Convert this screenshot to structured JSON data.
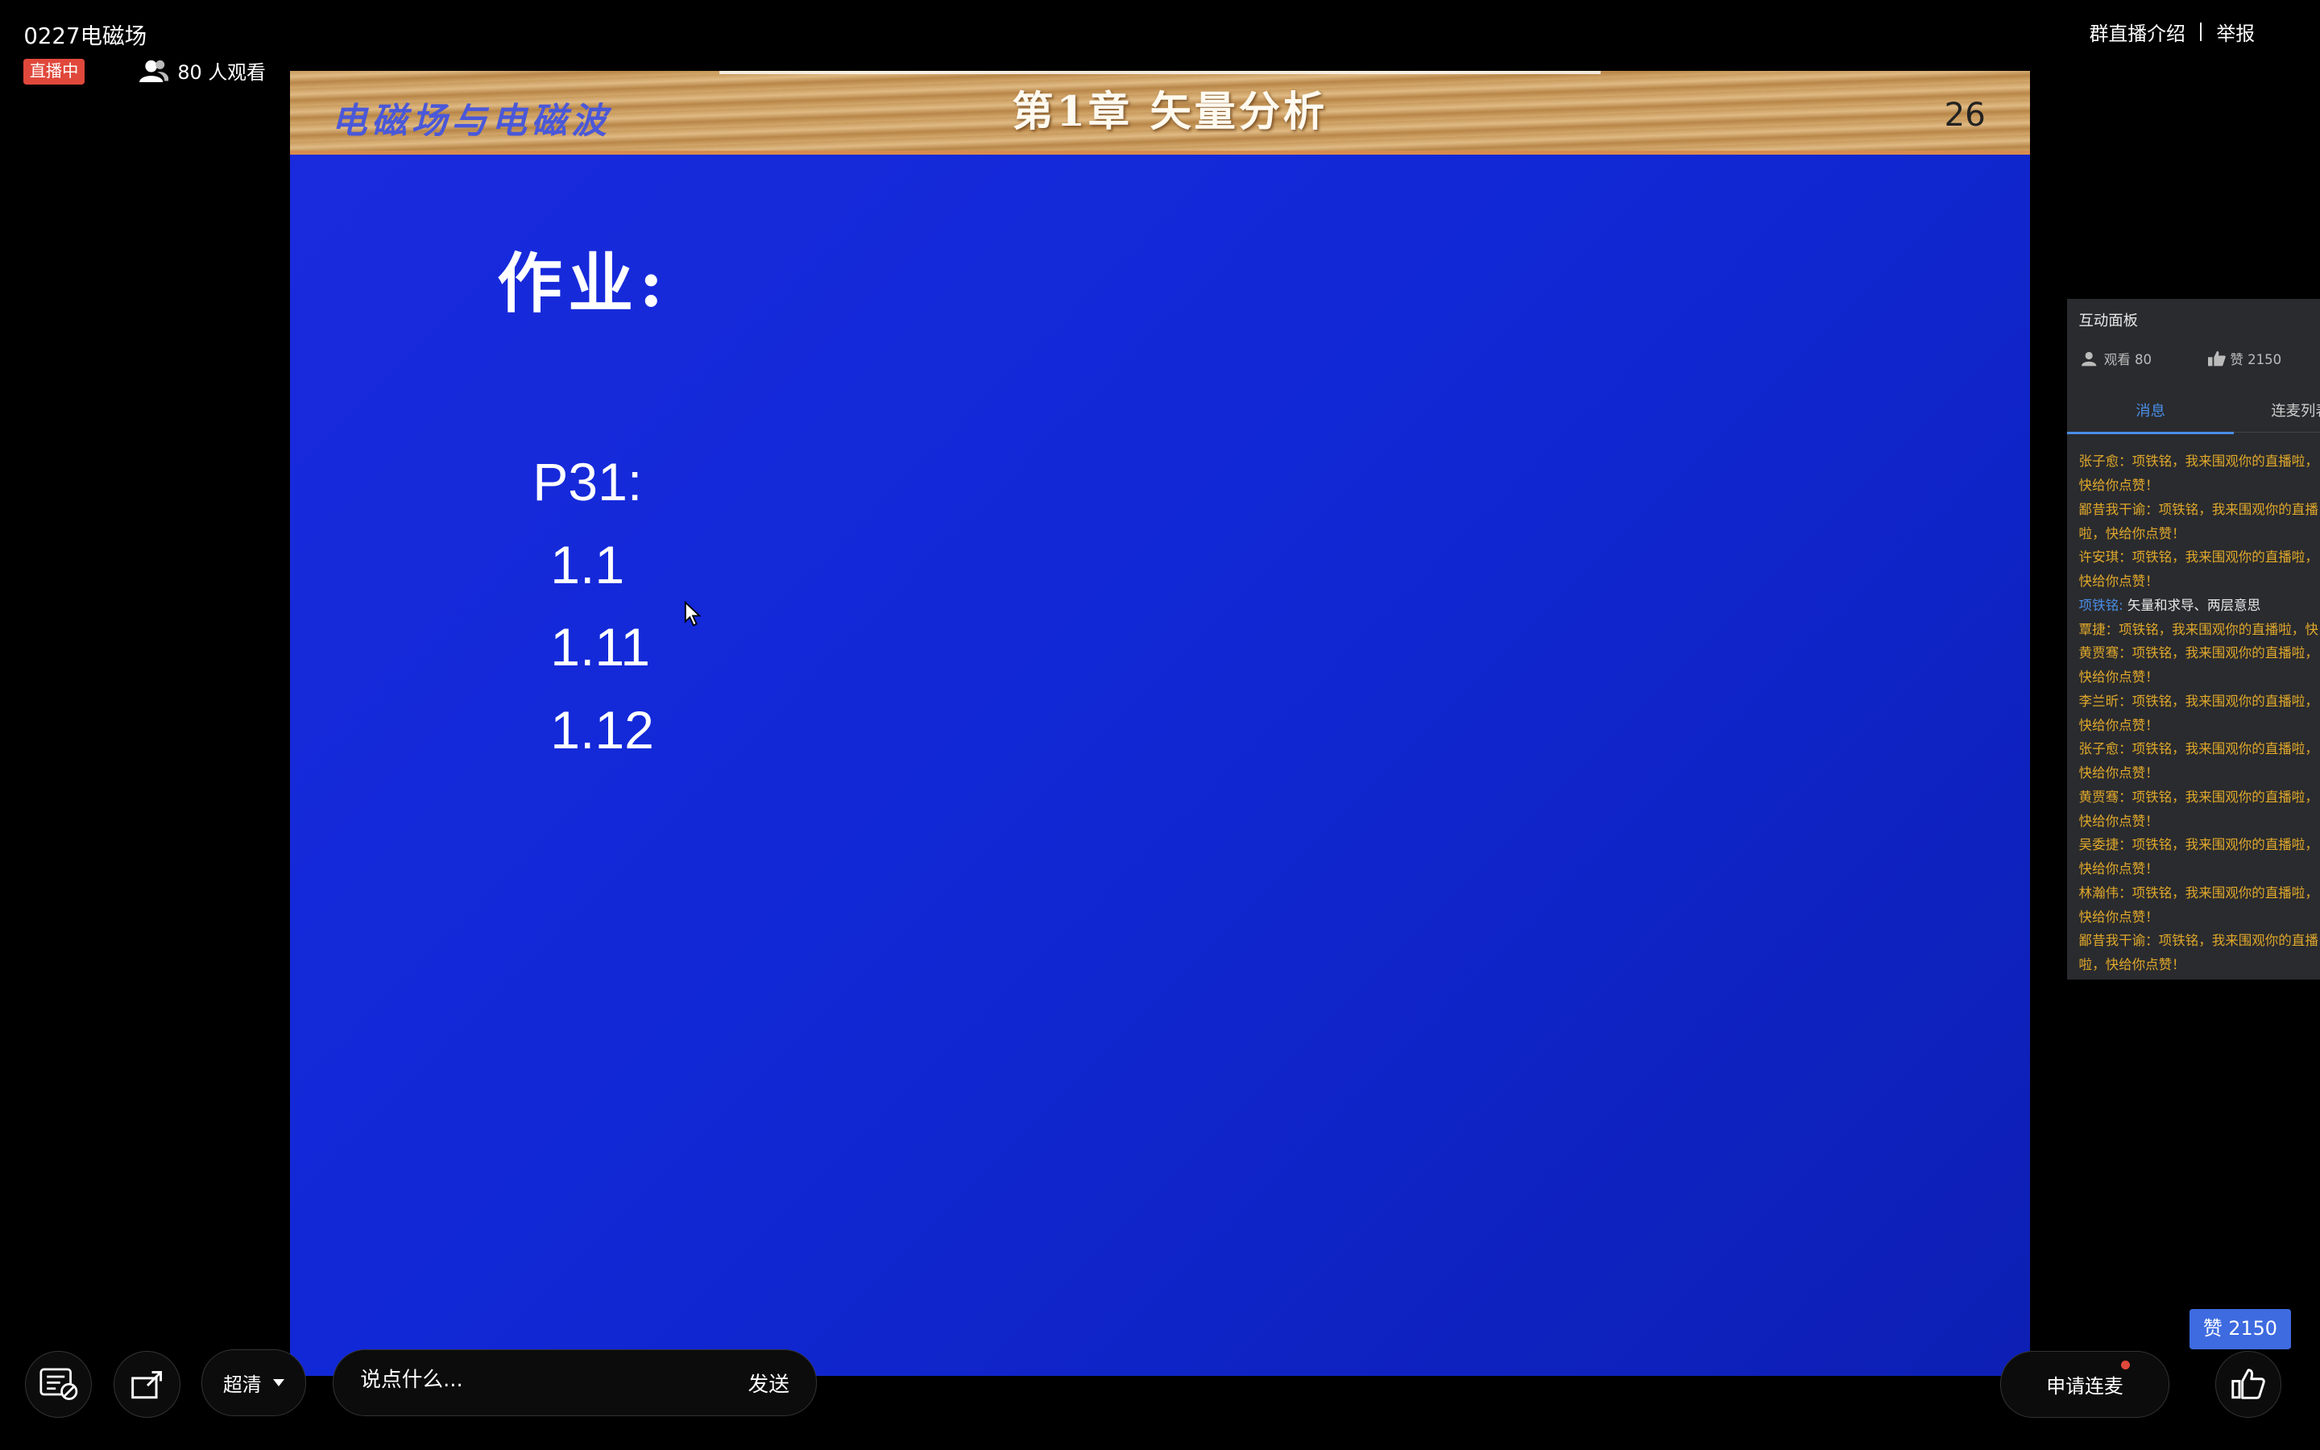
{
  "header": {
    "title": "0227电磁场",
    "live_badge": "直播中",
    "viewer_text": "80 人观看",
    "links": [
      "群直播介绍",
      "举报"
    ]
  },
  "slide": {
    "course_name": "电磁场与电磁波",
    "chapter_title": "第1章  矢量分析",
    "page_number": "26",
    "heading": "作业:",
    "items": [
      "P31:",
      "1.1",
      "1.11",
      "1.12"
    ]
  },
  "interaction_panel": {
    "title": "互动面板",
    "viewers": "观看 80",
    "likes": "赞 2150",
    "tabs": [
      "消息",
      "连麦列表"
    ],
    "messages": [
      {
        "text": "张子愈：项铁铭，我来围观你的直播啦，快给你点赞！"
      },
      {
        "text": "鄙昔我干谕：项铁铭，我来围观你的直播啦，快给你点赞！"
      },
      {
        "text": "许安琪：项铁铭，我来围观你的直播啦，快给你点赞！"
      },
      {
        "name": "项铁铭:",
        "text": "矢量和求导、两层意思",
        "host": true
      },
      {
        "text": "覃捷：项铁铭，我来围观你的直播啦，快给你点赞！",
        "single": true
      },
      {
        "text": "黄贾骞：项铁铭，我来围观你的直播啦，快给你点赞！"
      },
      {
        "text": "李兰昕：项铁铭，我来围观你的直播啦，快给你点赞！"
      },
      {
        "text": "张子愈：项铁铭，我来围观你的直播啦，快给你点赞！"
      },
      {
        "text": "黄贾骞：项铁铭，我来围观你的直播啦，快给你点赞！"
      },
      {
        "text": "吴委捷：项铁铭，我来围观你的直播啦，快给你点赞！"
      },
      {
        "text": "林瀚伟：项铁铭，我来围观你的直播啦，快给你点赞！"
      },
      {
        "text": "鄙昔我干谕：项铁铭，我来围观你的直播啦，快给你点赞！"
      }
    ]
  },
  "controls": {
    "quality": "超清",
    "chat_placeholder": "说点什么...",
    "send": "发送",
    "apply_mic": "申请连麦",
    "like_count": "赞 2150"
  },
  "colors": {
    "live_badge": "#e0483b",
    "slide_blue": "#1128d6",
    "accent_blue": "#4a8ee6",
    "message_orange": "#e0a82b",
    "like_badge": "#3e6be0"
  },
  "icons": {
    "viewer": "people-icon",
    "danmu": "danmaku-toggle-icon",
    "share": "share-icon",
    "like": "thumbs-up-icon",
    "cursor": "mouse-pointer-icon"
  }
}
